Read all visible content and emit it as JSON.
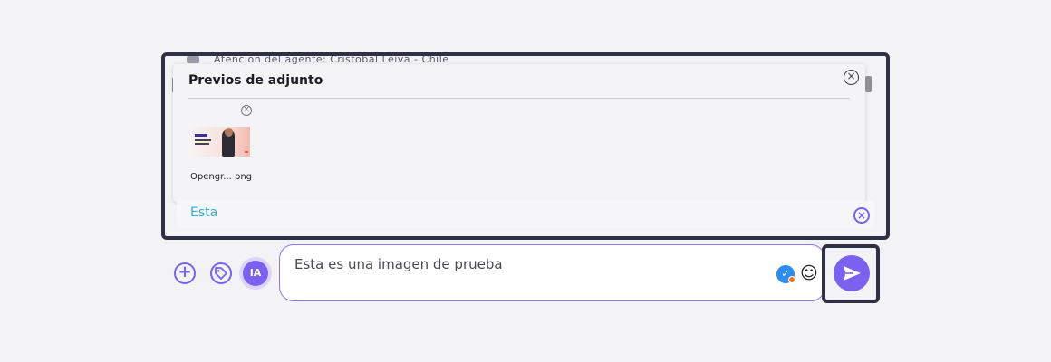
{
  "background_chat": {
    "truncated_text": "Atencion del agente: Cristobal Leiva - Chile"
  },
  "preview": {
    "title": "Previos de adjunto",
    "close_icon": "circle-x-icon",
    "attachments": [
      {
        "name": "Opengr... png",
        "remove_icon": "circle-x-icon"
      }
    ]
  },
  "reply": {
    "text": "Esta",
    "close_icon": "circle-x-icon"
  },
  "composer": {
    "add_icon": "plus-circle-icon",
    "tag_icon": "tag-icon",
    "ai_label": "IA",
    "message_text": "Esta es una imagen de prueba",
    "spell_icon": "check-circle-icon",
    "emoji_icon": "smiley-icon",
    "send_icon": "paper-plane-icon"
  },
  "colors": {
    "accent": "#7b61f0",
    "reply_text": "#2fb1d9",
    "highlight": "#2f3046"
  }
}
